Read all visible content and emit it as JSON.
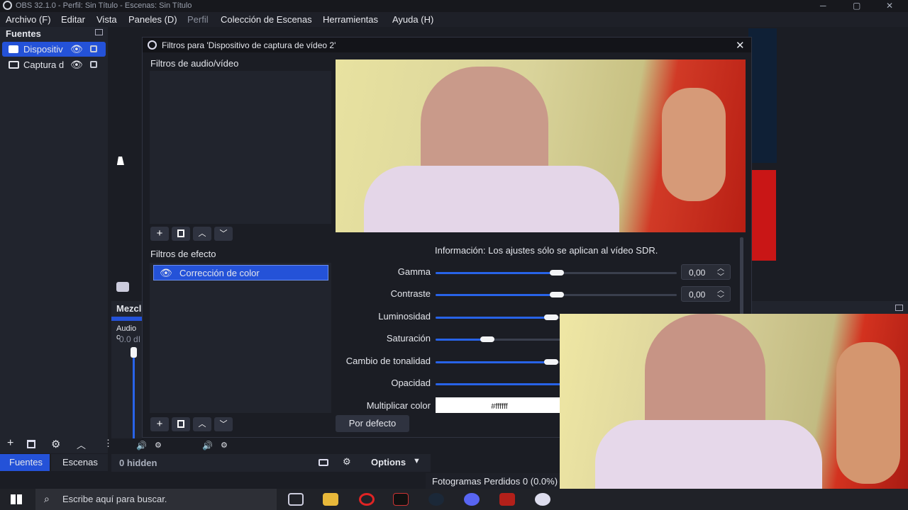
{
  "window": {
    "title": "OBS 32.1.0 - Perfil: Sin Título - Escenas: Sin Título",
    "min": "─",
    "max": "▢",
    "close": "✕"
  },
  "menu": [
    "Archivo (F)",
    "Editar",
    "Vista",
    "Paneles (D)",
    "Perfil",
    "Colección de Escenas",
    "Herramientas",
    "Ayuda (H)"
  ],
  "sources": {
    "title": "Fuentes",
    "items": [
      {
        "label": "Dispositiv",
        "icon": "camera-icon",
        "selected": true
      },
      {
        "label": "Captura d",
        "icon": "monitor-icon",
        "selected": false
      }
    ]
  },
  "dock_tabs": {
    "sources": "Fuentes",
    "scenes": "Escenas"
  },
  "mixer": {
    "title": "Mezcl",
    "audio_label": "Audio c",
    "db": "0.0 dI"
  },
  "bottom_bar": {
    "hidden": "0 hidden",
    "options": "Options"
  },
  "status": {
    "dropped_frames": "Fotogramas Perdidos 0 (0.0%)"
  },
  "dialog": {
    "title": "Filtros para 'Dispositivo de captura de vídeo 2'",
    "audio_video_label": "Filtros de audio/vídeo",
    "effects_label": "Filtros de efecto",
    "effect_items": [
      {
        "label": "Corrección de color",
        "selected": true
      }
    ],
    "info": "Información: Los ajustes sólo se aplican al vídeo SDR.",
    "reset_button": "Por defecto",
    "properties": [
      {
        "label": "Gamma",
        "value": "0,00",
        "level": 0.5
      },
      {
        "label": "Contraste",
        "value": "0,00",
        "level": 0.5
      },
      {
        "label": "Luminosidad",
        "value": "",
        "level": 0.5
      },
      {
        "label": "Saturación",
        "value": "",
        "level": 0.2
      },
      {
        "label": "Cambio de tonalidad",
        "value": "",
        "level": 0.5
      },
      {
        "label": "Opacidad",
        "value": "",
        "level": 1.0
      },
      {
        "label": "Multiplicar color",
        "value": "#ffffff",
        "level": null
      }
    ]
  },
  "taskbar": {
    "search_placeholder": "Escribe aquí para buscar."
  }
}
